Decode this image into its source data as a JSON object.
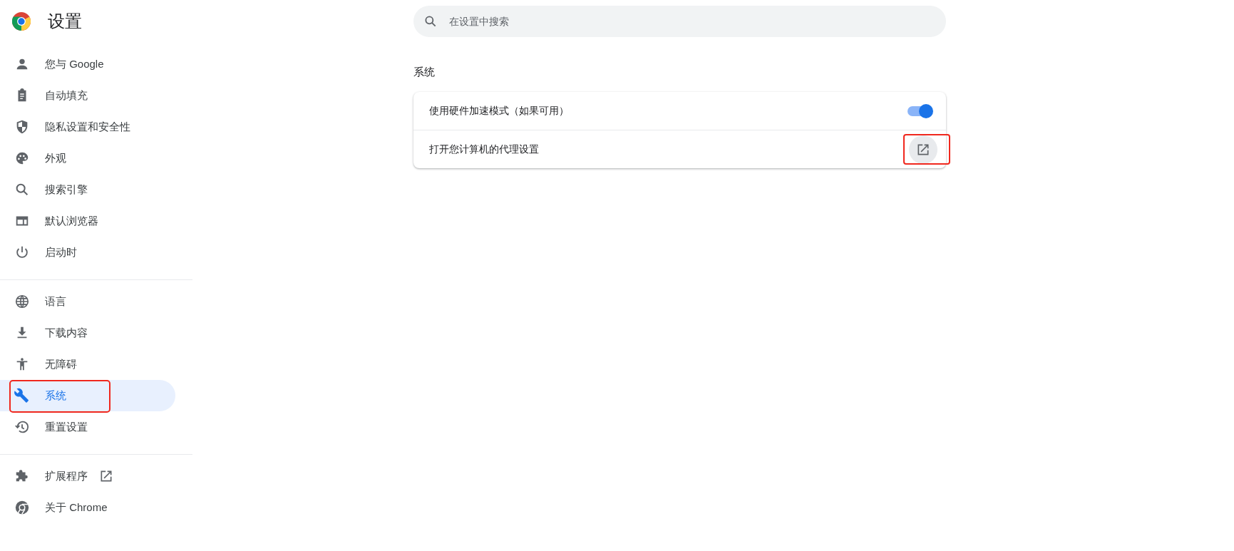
{
  "header": {
    "title": "设置"
  },
  "sidebar": {
    "groups": [
      {
        "items": [
          {
            "label": "您与 Google",
            "selected": false,
            "annotated": false,
            "external": false
          },
          {
            "label": "自动填充",
            "selected": false,
            "annotated": false,
            "external": false
          },
          {
            "label": "隐私设置和安全性",
            "selected": false,
            "annotated": false,
            "external": false
          },
          {
            "label": "外观",
            "selected": false,
            "annotated": false,
            "external": false
          },
          {
            "label": "搜索引擎",
            "selected": false,
            "annotated": false,
            "external": false
          },
          {
            "label": "默认浏览器",
            "selected": false,
            "annotated": false,
            "external": false
          },
          {
            "label": "启动时",
            "selected": false,
            "annotated": false,
            "external": false
          }
        ]
      },
      {
        "items": [
          {
            "label": "语言",
            "selected": false,
            "annotated": false,
            "external": false
          },
          {
            "label": "下载内容",
            "selected": false,
            "annotated": false,
            "external": false
          },
          {
            "label": "无障碍",
            "selected": false,
            "annotated": false,
            "external": false
          },
          {
            "label": "系统",
            "selected": true,
            "annotated": true,
            "external": false
          },
          {
            "label": "重置设置",
            "selected": false,
            "annotated": false,
            "external": false
          }
        ]
      },
      {
        "items": [
          {
            "label": "扩展程序",
            "selected": false,
            "annotated": false,
            "external": true
          },
          {
            "label": "关于 Chrome",
            "selected": false,
            "annotated": false,
            "external": false
          }
        ]
      }
    ]
  },
  "search": {
    "placeholder": "在设置中搜索"
  },
  "section": {
    "title": "系统",
    "rows": [
      {
        "kind": "toggle",
        "label": "使用硬件加速模式（如果可用）",
        "on": true,
        "annotated": false
      },
      {
        "kind": "external",
        "label": "打开您计算机的代理设置",
        "annotated": true
      }
    ]
  }
}
